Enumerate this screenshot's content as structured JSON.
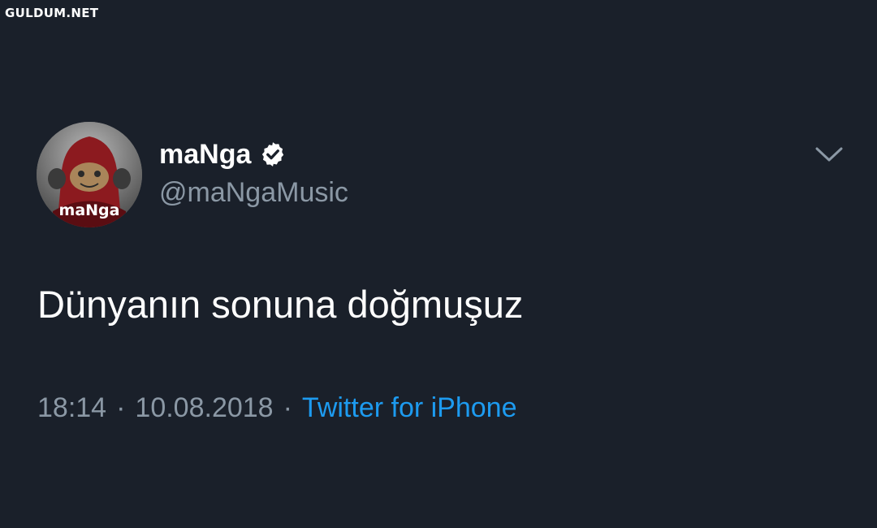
{
  "watermark": "GULDUM.NET",
  "tweet": {
    "avatar_text": "maNga",
    "display_name": "maNga",
    "handle": "@maNgaMusic",
    "verified": true,
    "text": "Dünyanın sonuna doğmuşuz",
    "time": "18:14",
    "separator": "·",
    "date": "10.08.2018",
    "source": "Twitter for iPhone"
  },
  "icons": {
    "verified": "verified-badge-icon",
    "menu": "chevron-down-icon"
  },
  "colors": {
    "background": "#1a202a",
    "primary_text": "#ffffff",
    "secondary_text": "#8b98a5",
    "link": "#1d9bf0"
  }
}
